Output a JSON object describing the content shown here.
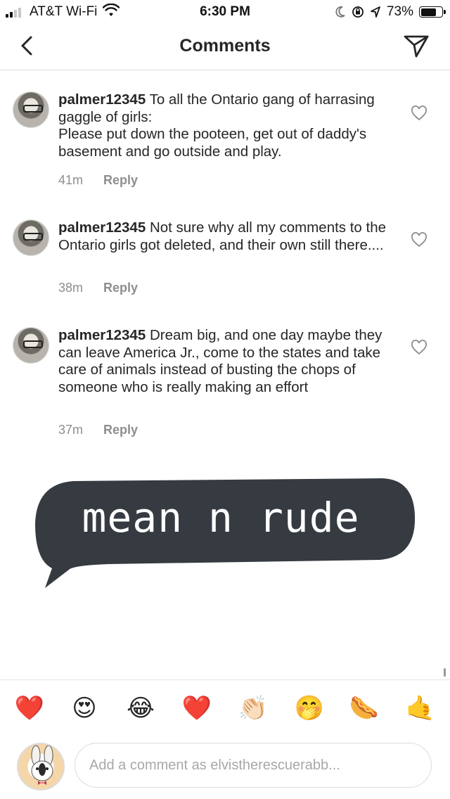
{
  "status_bar": {
    "carrier": "AT&T Wi-Fi",
    "time": "6:30 PM",
    "battery_percent": "73%",
    "battery_level": 0.73
  },
  "nav": {
    "title": "Comments",
    "back_icon": "chevron-left-icon",
    "send_icon": "paper-plane-icon"
  },
  "comments": [
    {
      "username": "palmer12345",
      "text": "To all the Ontario gang of harrasing gaggle of girls:",
      "text2": "Please put down the pooteen,  get out of daddy's basement and go outside and play.",
      "time": "41m",
      "reply": "Reply"
    },
    {
      "username": "palmer12345",
      "text": "Not sure why all my comments to the Ontario girls got deleted, and their own still there....",
      "time": "38m",
      "reply": "Reply"
    },
    {
      "username": "palmer12345",
      "text": "Dream big, and one day maybe they can leave America Jr., come to the states and take care of animals instead of busting the chops of someone who is really making an effort",
      "time": "37m",
      "reply": "Reply"
    }
  ],
  "sticker": {
    "text": "mean n rude",
    "color": "#363b41"
  },
  "emoji_bar": [
    {
      "name": "red-heart-icon",
      "glyph": "❤️"
    },
    {
      "name": "heart-eyes-icon",
      "glyph": "😍"
    },
    {
      "name": "tears-of-joy-icon",
      "glyph": "😂"
    },
    {
      "name": "red-heart-icon",
      "glyph": "❤️"
    },
    {
      "name": "clapping-hands-icon",
      "glyph": "👏🏻"
    },
    {
      "name": "hand-over-mouth-icon",
      "glyph": "🤭"
    },
    {
      "name": "hot-dog-icon",
      "glyph": "🌭"
    },
    {
      "name": "call-me-hand-icon",
      "glyph": "🤙"
    }
  ],
  "composer": {
    "placeholder": "Add a comment as elvistherescuerabb..."
  },
  "colors": {
    "text": "#262626",
    "muted": "#8e8e8e",
    "divider": "#dbdbdb"
  }
}
